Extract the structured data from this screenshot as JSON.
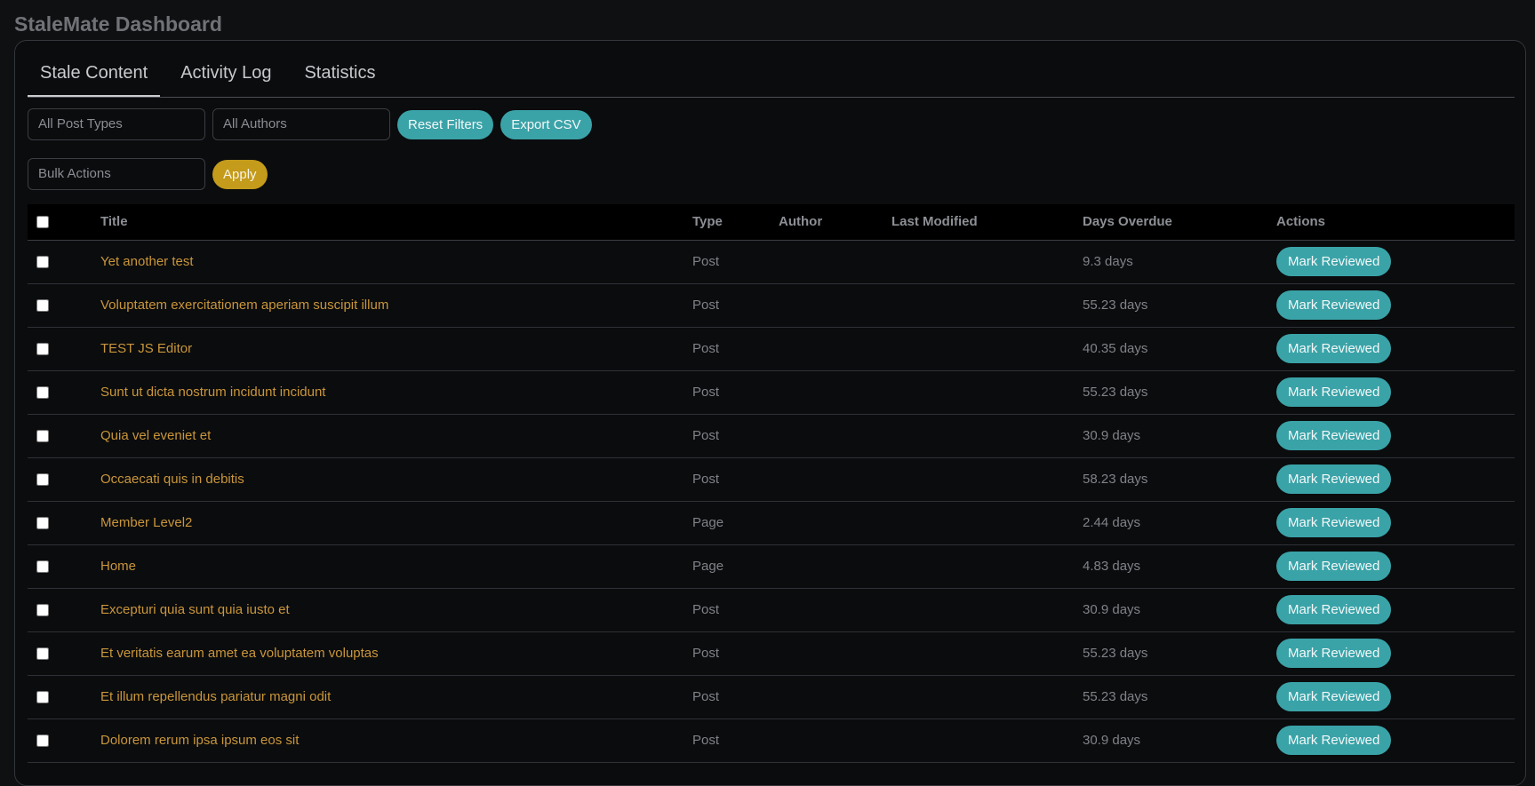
{
  "app": {
    "title": "StaleMate Dashboard"
  },
  "tabs": [
    {
      "label": "Stale Content",
      "active": true
    },
    {
      "label": "Activity Log",
      "active": false
    },
    {
      "label": "Statistics",
      "active": false
    }
  ],
  "filters": {
    "post_types_placeholder": "All Post Types",
    "authors_placeholder": "All Authors",
    "reset_label": "Reset Filters",
    "export_label": "Export CSV"
  },
  "bulk": {
    "placeholder": "Bulk Actions",
    "apply_label": "Apply"
  },
  "table": {
    "headers": {
      "title": "Title",
      "type": "Type",
      "author": "Author",
      "last_modified": "Last Modified",
      "days_overdue": "Days Overdue",
      "actions": "Actions"
    },
    "action_label": "Mark Reviewed",
    "rows": [
      {
        "title": "Yet another test",
        "type": "Post",
        "author": "",
        "last_modified": "",
        "days_overdue": "9.3 days"
      },
      {
        "title": "Voluptatem exercitationem aperiam suscipit illum",
        "type": "Post",
        "author": "",
        "last_modified": "",
        "days_overdue": "55.23 days"
      },
      {
        "title": "TEST JS Editor",
        "type": "Post",
        "author": "",
        "last_modified": "",
        "days_overdue": "40.35 days"
      },
      {
        "title": "Sunt ut dicta nostrum incidunt incidunt",
        "type": "Post",
        "author": "",
        "last_modified": "",
        "days_overdue": "55.23 days"
      },
      {
        "title": "Quia vel eveniet et",
        "type": "Post",
        "author": "",
        "last_modified": "",
        "days_overdue": "30.9 days"
      },
      {
        "title": "Occaecati quis in debitis",
        "type": "Post",
        "author": "",
        "last_modified": "",
        "days_overdue": "58.23 days"
      },
      {
        "title": "Member Level2",
        "type": "Page",
        "author": "",
        "last_modified": "",
        "days_overdue": "2.44 days"
      },
      {
        "title": "Home",
        "type": "Page",
        "author": "",
        "last_modified": "",
        "days_overdue": "4.83 days"
      },
      {
        "title": "Excepturi quia sunt quia iusto et",
        "type": "Post",
        "author": "",
        "last_modified": "",
        "days_overdue": "30.9 days"
      },
      {
        "title": "Et veritatis earum amet ea voluptatem voluptas",
        "type": "Post",
        "author": "",
        "last_modified": "",
        "days_overdue": "55.23 days"
      },
      {
        "title": "Et illum repellendus pariatur magni odit",
        "type": "Post",
        "author": "",
        "last_modified": "",
        "days_overdue": "55.23 days"
      },
      {
        "title": "Dolorem rerum ipsa ipsum eos sit",
        "type": "Post",
        "author": "",
        "last_modified": "",
        "days_overdue": "30.9 days"
      }
    ]
  },
  "colors": {
    "accent_teal": "#3aa3a8",
    "accent_gold": "#c49b1a",
    "title_link": "#c9963a"
  }
}
